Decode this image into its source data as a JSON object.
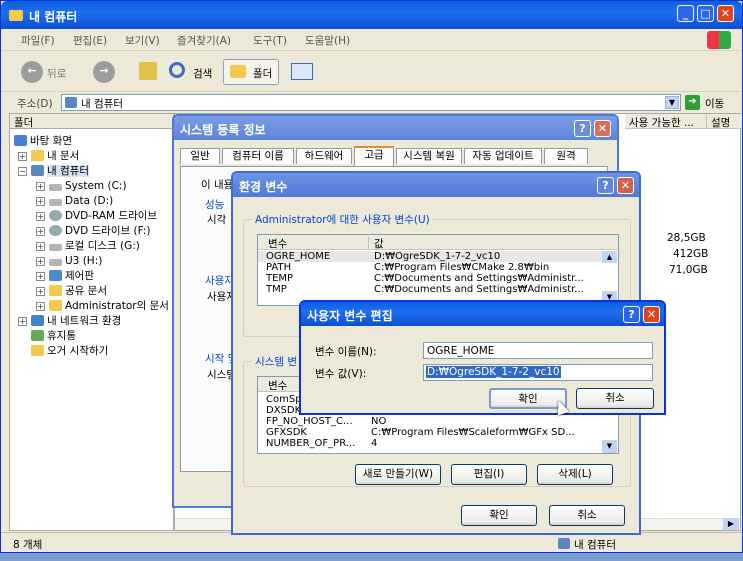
{
  "explorer": {
    "title": "내 컴퓨터",
    "menu": [
      "파일(F)",
      "편집(E)",
      "보기(V)",
      "즐겨찾기(A)",
      "도구(T)",
      "도움말(H)"
    ],
    "toolbar": {
      "back": "뒤로",
      "search": "검색",
      "folders": "폴더"
    },
    "address_label": "주소(D)",
    "address_value": "내 컴퓨터",
    "go": "이동",
    "folder_pane_title": "폴더",
    "col_available": "사용 가능한 ...",
    "col_desc": "설명",
    "sizes": [
      "28,5GB",
      "412GB",
      "71,0GB"
    ],
    "tree": [
      "바탕 화면",
      "내 문서",
      "내 컴퓨터",
      "System (C:)",
      "Data (D:)",
      "DVD-RAM 드라이브",
      "DVD 드라이브 (F:)",
      "로컬 디스크 (G:)",
      "U3 (H:)",
      "제어판",
      "공유 문서",
      "Administrator의 문서",
      "내 네트워크 환경",
      "휴지통",
      "오거 시작하기"
    ],
    "status_left": "8 개체",
    "status_right": "내 컴퓨터"
  },
  "sysprops": {
    "title": "시스템 등록 정보",
    "tabs": [
      "일반",
      "컴퓨터 이름",
      "하드웨어",
      "고급",
      "시스템 복원",
      "자동 업데이트",
      "원격"
    ],
    "frag1": "이 내용",
    "frag2": "성능",
    "frag3": "시각",
    "frag4": "사용자",
    "frag5": "사용자",
    "frag6": "시작 및",
    "frag7": "시스템"
  },
  "envvars": {
    "title": "환경 변수",
    "user_group": "Administrator에 대한 사용자 변수(U)",
    "col_var": "변수",
    "col_val": "값",
    "user_vars": [
      {
        "name": "OGRE_HOME",
        "value": "D:₩OgreSDK_1-7-2_vc10"
      },
      {
        "name": "PATH",
        "value": "C:₩Program Files₩CMake 2.8₩bin"
      },
      {
        "name": "TEMP",
        "value": "C:₩Documents and Settings₩Administr..."
      },
      {
        "name": "TMP",
        "value": "C:₩Documents and Settings₩Administr..."
      }
    ],
    "sys_group": "시스템 변",
    "sys_vars": [
      {
        "name": "ComSp",
        "value": ""
      },
      {
        "name": "DXSDK",
        "value": ""
      },
      {
        "name": "FP_NO_HOST_C...",
        "value": "NO"
      },
      {
        "name": "GFXSDK",
        "value": "C:₩Program Files₩Scaleform₩GFx SD..."
      },
      {
        "name": "NUMBER_OF_PR...",
        "value": "4"
      }
    ],
    "new_btn": "새로 만들기(W)",
    "edit_btn": "편집(I)",
    "delete_btn": "삭제(L)",
    "ok": "확인",
    "cancel": "취소"
  },
  "editdlg": {
    "title": "사용자 변수 편집",
    "name_label": "변수 이름(N):",
    "name_value": "OGRE_HOME",
    "value_label": "변수 값(V):",
    "value_value": "D:₩OgreSDK_1-7-2_vc10",
    "ok": "확인",
    "cancel": "취소"
  }
}
